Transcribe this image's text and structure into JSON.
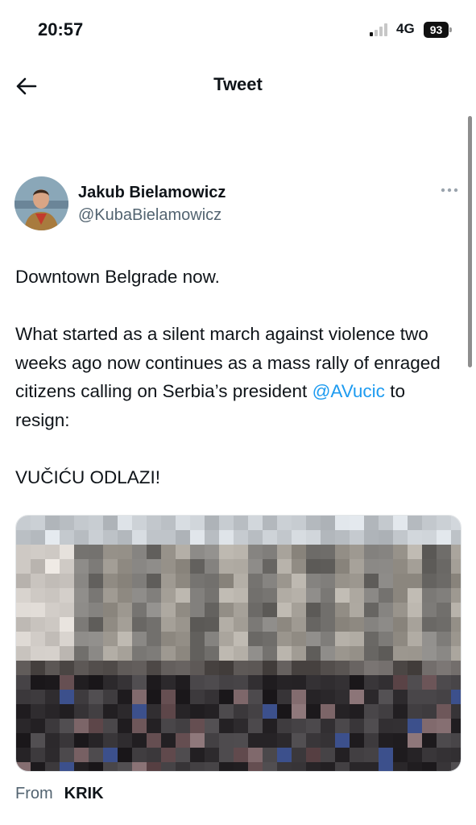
{
  "status_bar": {
    "time": "20:57",
    "network": "4G",
    "battery": "93"
  },
  "nav": {
    "title": "Tweet",
    "back_icon": "arrow-left-icon"
  },
  "author": {
    "name": "Jakub Bielamowicz",
    "handle": "@KubaBielamowicz"
  },
  "tweet": {
    "line1": "Downtown Belgrade now.",
    "para2_before_mention": "What started as a silent march against violence two weeks ago now continues as a mass rally of enraged citizens calling on Serbia’s president",
    "mention": "@AVucic",
    "para2_after_mention": " to resign:",
    "line3": "VUČIĆU ODLAZI!"
  },
  "media": {
    "type": "image",
    "pixelated": true
  },
  "source": {
    "label": "From",
    "name": "KRIK"
  },
  "colors": {
    "link": "#1d9bf0",
    "secondary_text": "#536471",
    "primary_text": "#0f1419"
  }
}
